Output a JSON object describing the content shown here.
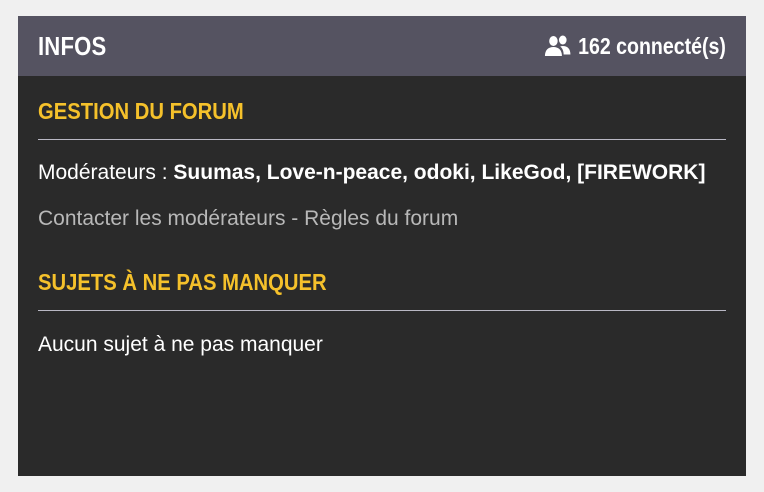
{
  "header": {
    "title": "INFOS",
    "online_icon": "users-icon",
    "online_count": "162 connecté(s)"
  },
  "management": {
    "title": "GESTION DU FORUM",
    "moderators_label": "Modérateurs :",
    "moderators": "Suumas, Love-n-peace, odoki, LikeGod, [FIREWORK]",
    "contact_link": "Contacter les modérateurs",
    "separator": "-",
    "rules_link": "Règles du forum"
  },
  "must_read": {
    "title": "SUJETS À NE PAS MANQUER",
    "empty_text": "Aucun sujet à ne pas manquer"
  },
  "colors": {
    "header_bg": "#555361",
    "panel_bg": "#2a2a2a",
    "accent": "#f5c12b"
  }
}
